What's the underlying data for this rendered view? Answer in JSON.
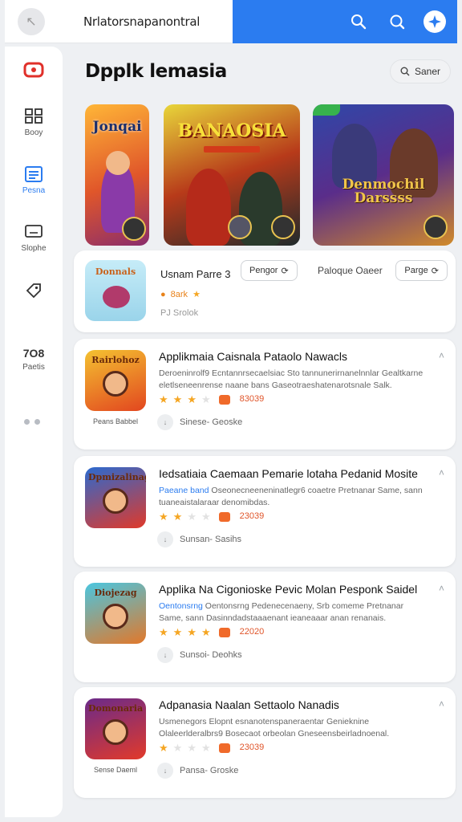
{
  "topbar": {
    "title": "Nrlatorsnapanontral"
  },
  "sidebar": {
    "items": [
      {
        "label": "",
        "icon": "gamepad-icon",
        "color": "#e0302a"
      },
      {
        "label": "Booy",
        "icon": "grid-icon"
      },
      {
        "label": "Pesna",
        "icon": "list-icon",
        "active": true
      },
      {
        "label": "Slophe",
        "icon": "monitor-icon"
      },
      {
        "label": "",
        "icon": "tag-icon"
      },
      {
        "label": "Paetis",
        "number": "7O8"
      }
    ]
  },
  "main": {
    "title": "Dpplk lemasia",
    "search_label": "Saner"
  },
  "banners": [
    {
      "text": "Jonqai"
    },
    {
      "text": "BANAOSIA"
    },
    {
      "text": "Denmochil Darssss"
    }
  ],
  "featured": {
    "thumb_text": "Donnals",
    "name": "Usnam Parre 3",
    "rating": "8ark",
    "meta": "PJ   Srolok",
    "pill1": "Pengor",
    "secondary": "Paloque Oaeer",
    "pill2": "Parge"
  },
  "apps": [
    {
      "thumb_text": "Rairlohoz",
      "caption": "Peans Babbel",
      "title": "Applikmaia Caisnala Pataolo Nawacls",
      "desc": "Deroeninrolf9 Ecntannrsecaelsiac Sto tannunerirnanelnnlar Gealtkarne eletlseneenrense naane bans Gaseotraeshatenarotsnale Salk.",
      "stars": 3,
      "count": "83039",
      "foot": "Sinese-  Geoske",
      "colors": [
        "#f4c231",
        "#e2461f"
      ]
    },
    {
      "thumb_text": "Dpmizalinag",
      "caption": "",
      "title": "Iedsatiaia Caemaan Pemarie lotaha Pedanid Mosite",
      "highlight": "Paeane band",
      "desc": "Oseonecneeneninatlegr6 coaetre Pretnanar Same, sann tuaneaistalaraar denomibdas.",
      "stars": 2,
      "count": "23039",
      "foot": "Sunsan-  Sasihs",
      "colors": [
        "#2b6ad0",
        "#e0392a"
      ]
    },
    {
      "thumb_text": "Diojezag",
      "caption": "",
      "title": "Applika Na Cigonioske Pevic Molan Pesponk Saidel",
      "highlight": "Oentonsrng",
      "desc": "Oentonsrng Pedenecenaeny, Srb comeme Pretnanar Same, sann Dasinndadstaaaenant ieaneaaar anan renanais.",
      "stars": 4,
      "count": "22020",
      "foot": "Sunsoi-  Deohks",
      "colors": [
        "#4ac6e0",
        "#e2782a"
      ]
    },
    {
      "thumb_text": "Domonaria",
      "caption": "Sense Daeml",
      "title": "Adpanasia Naalan Settaolo Nanadis",
      "desc": "Usmenegors Elopnt esnanotenspaneraentar Genieknine Olaleerlderalbrs9 Bosecaot orbeolan Gneseensbeirladnoenal.",
      "stars": 1,
      "count": "23039",
      "foot": "Pansa-  Groske",
      "colors": [
        "#6a2a8a",
        "#e23a2a"
      ]
    }
  ]
}
